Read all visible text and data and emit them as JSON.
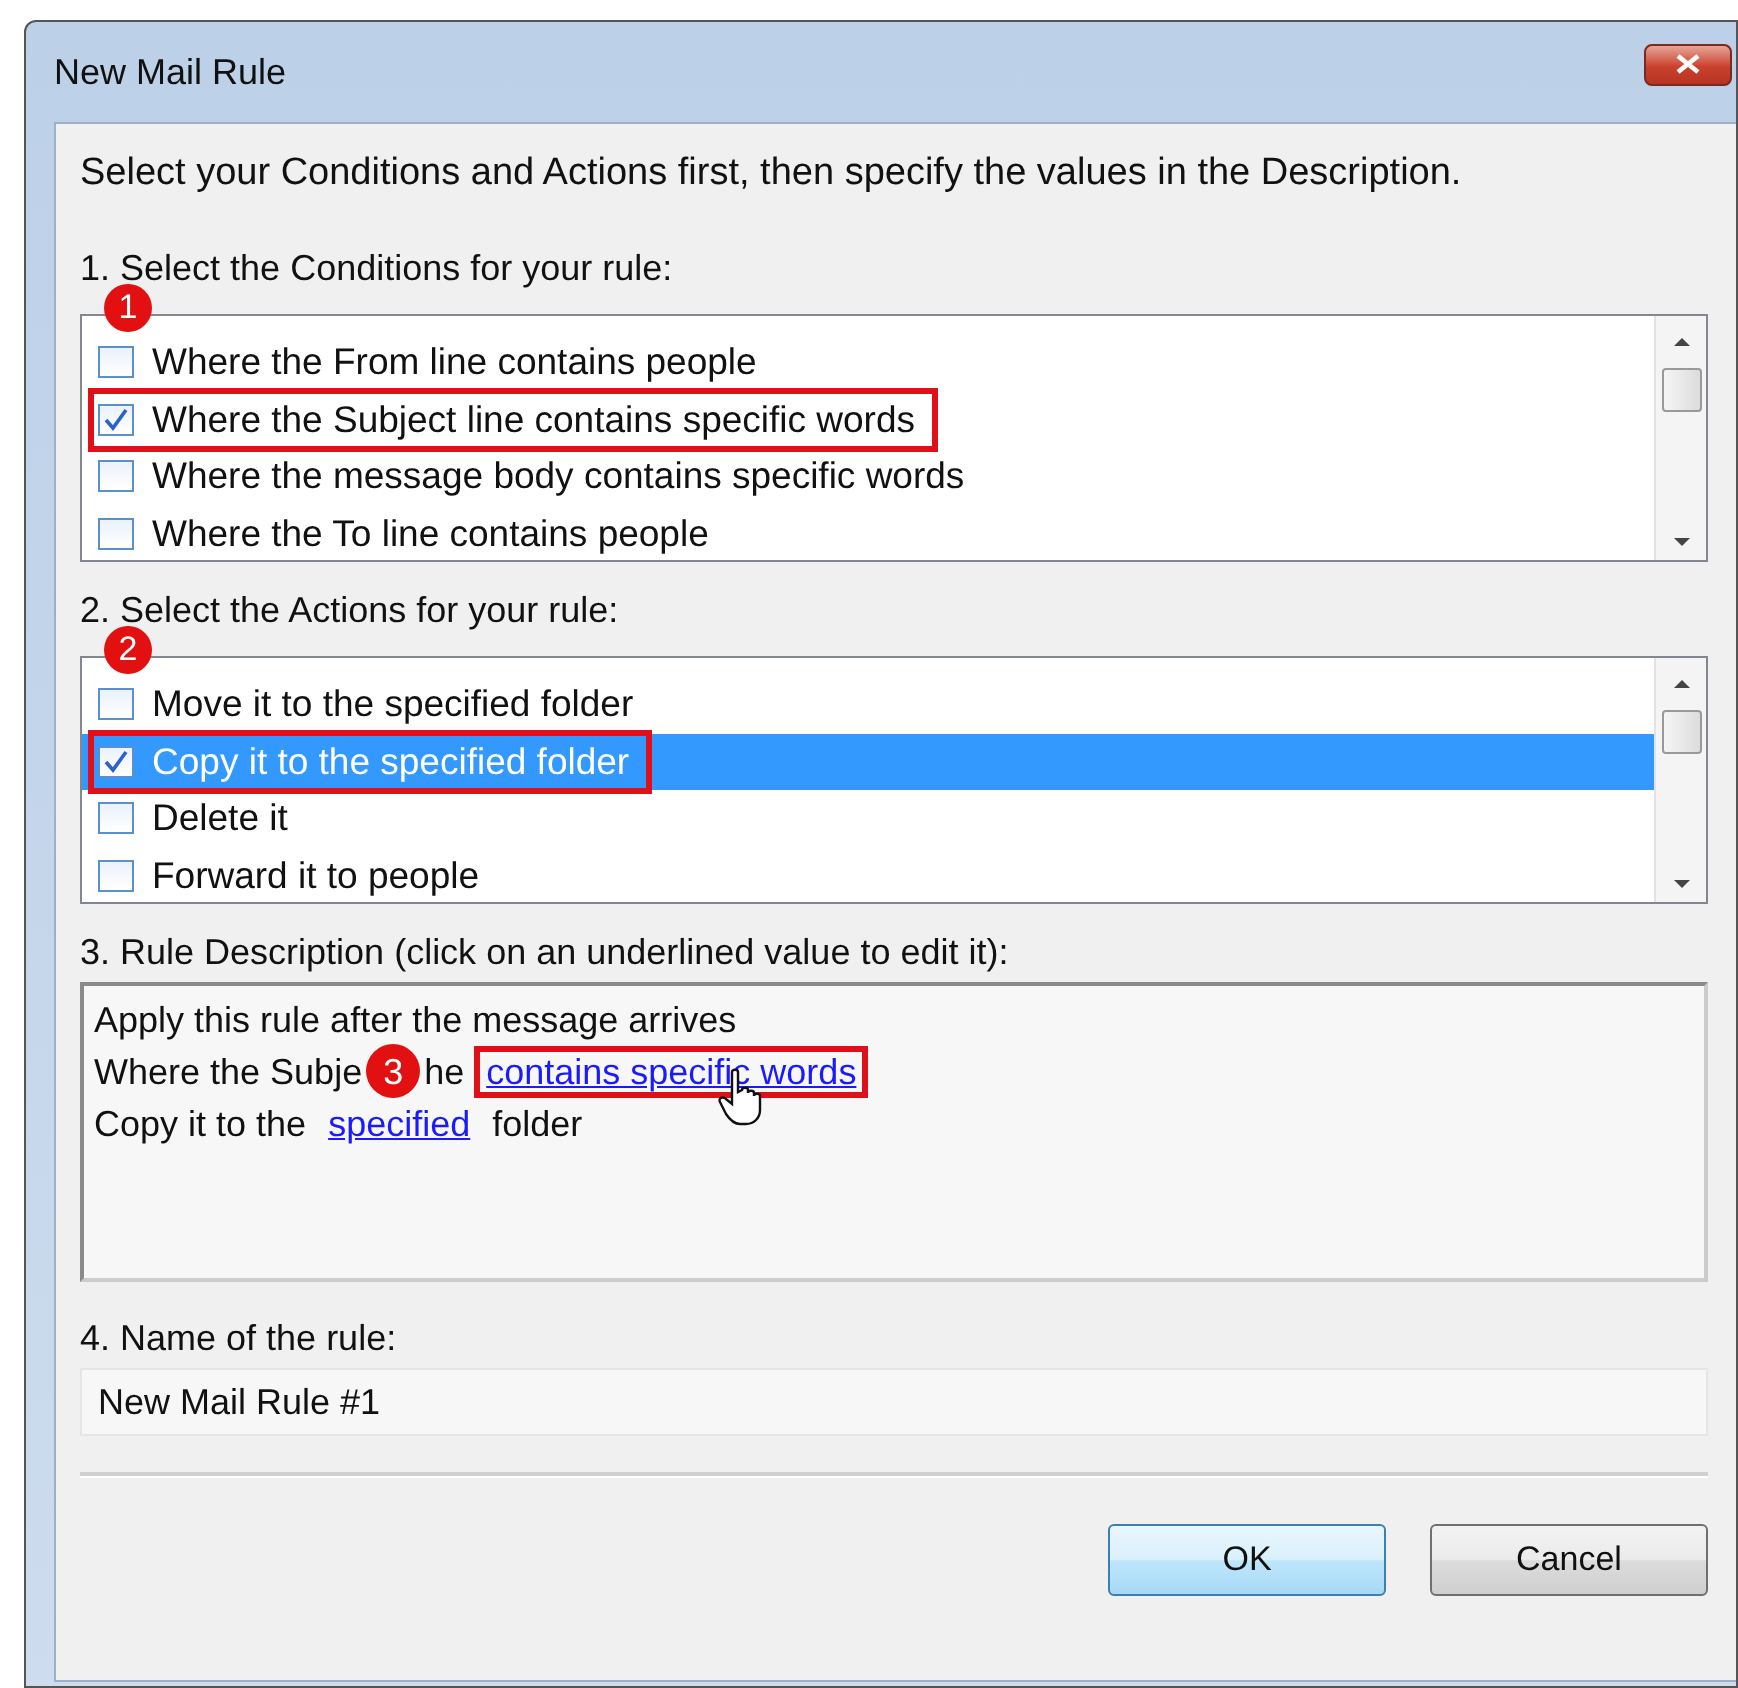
{
  "window": {
    "title": "New Mail Rule"
  },
  "instructions": "Select your Conditions and Actions first, then specify the values in the Description.",
  "conditions": {
    "label": "1. Select the Conditions for your rule:",
    "badge": "1",
    "items": [
      {
        "label": "Where the From line contains people",
        "checked": false,
        "selected": false,
        "outlined": false
      },
      {
        "label": "Where the Subject line contains specific words",
        "checked": true,
        "selected": false,
        "outlined": true
      },
      {
        "label": "Where the message body contains specific words",
        "checked": false,
        "selected": false,
        "outlined": false
      },
      {
        "label": "Where the To line contains people",
        "checked": false,
        "selected": false,
        "outlined": false
      }
    ]
  },
  "actions": {
    "label": "2. Select the Actions for your rule:",
    "badge": "2",
    "items": [
      {
        "label": "Move it to the specified folder",
        "checked": false,
        "selected": false,
        "outlined": false
      },
      {
        "label": "Copy it to the specified folder",
        "checked": true,
        "selected": true,
        "outlined": true
      },
      {
        "label": "Delete it",
        "checked": false,
        "selected": false,
        "outlined": false
      },
      {
        "label": "Forward it to people",
        "checked": false,
        "selected": false,
        "outlined": false
      }
    ]
  },
  "description": {
    "label": "3. Rule Description (click on an underlined value to edit it):",
    "lines": [
      {
        "parts": [
          {
            "kind": "text",
            "text": "Apply this rule after the message arrives"
          }
        ]
      },
      {
        "parts": [
          {
            "kind": "text",
            "text": "Where the Subje"
          },
          {
            "kind": "badge",
            "text": "3"
          },
          {
            "kind": "text",
            "text": "he "
          },
          {
            "kind": "link",
            "text": "contains specific words",
            "outlined": true,
            "hovered": true
          }
        ]
      },
      {
        "parts": [
          {
            "kind": "text",
            "text": "Copy it to the "
          },
          {
            "kind": "link",
            "text": "specified",
            "outlined": false,
            "hovered": false
          },
          {
            "kind": "text",
            "text": " folder"
          }
        ]
      }
    ]
  },
  "name": {
    "label": "4. Name of the rule:",
    "value": "New Mail Rule #1"
  },
  "buttons": [
    {
      "label": "OK",
      "default": true
    },
    {
      "label": "Cancel",
      "default": false
    }
  ]
}
